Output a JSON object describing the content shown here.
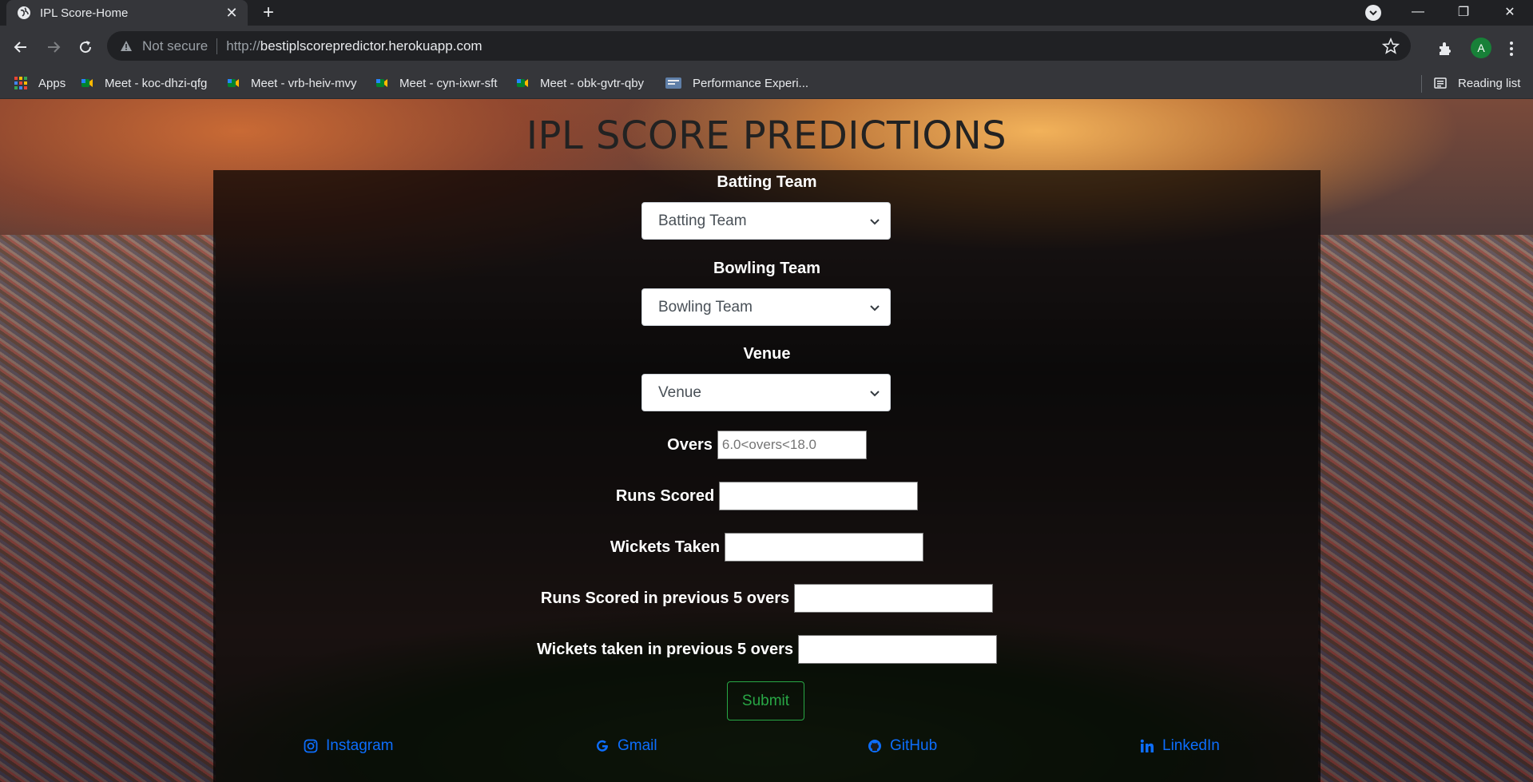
{
  "browser": {
    "tab_title": "IPL Score-Home",
    "not_secure": "Not secure",
    "url_scheme": "http://",
    "url_host": "bestiplscorepredictor.herokuapp.com",
    "profile_initial": "A",
    "bookmarks": [
      {
        "label": "Apps"
      },
      {
        "label": "Meet - koc-dhzi-qfg"
      },
      {
        "label": "Meet - vrb-heiv-mvy"
      },
      {
        "label": "Meet - cyn-ixwr-sft"
      },
      {
        "label": "Meet - obk-gvtr-qby"
      },
      {
        "label": "Performance Experi..."
      }
    ],
    "reading_list": "Reading list"
  },
  "page": {
    "title": "IPL SCORE PREDICTIONS",
    "batting_team": {
      "label": "Batting Team",
      "selected": "Batting Team"
    },
    "bowling_team": {
      "label": "Bowling Team",
      "selected": "Bowling Team"
    },
    "venue": {
      "label": "Venue",
      "selected": "Venue"
    },
    "overs": {
      "label": "Overs",
      "placeholder": "6.0<overs<18.0",
      "value": ""
    },
    "runs_scored": {
      "label": "Runs Scored",
      "value": ""
    },
    "wickets_taken": {
      "label": "Wickets Taken",
      "value": ""
    },
    "runs_prev5": {
      "label": "Runs Scored in previous 5 overs",
      "value": ""
    },
    "wickets_prev5": {
      "label": "Wickets taken in previous 5 overs",
      "value": ""
    },
    "submit_label": "Submit",
    "footer_links": [
      {
        "label": "Instagram",
        "icon": "instagram-icon"
      },
      {
        "label": "Gmail",
        "icon": "google-icon"
      },
      {
        "label": "GitHub",
        "icon": "github-icon"
      },
      {
        "label": "LinkedIn",
        "icon": "linkedin-icon"
      }
    ]
  },
  "colors": {
    "link": "#0d6efd",
    "submit_outline": "#28a745",
    "panel_overlay": "rgba(0,0,0,0.72)"
  }
}
